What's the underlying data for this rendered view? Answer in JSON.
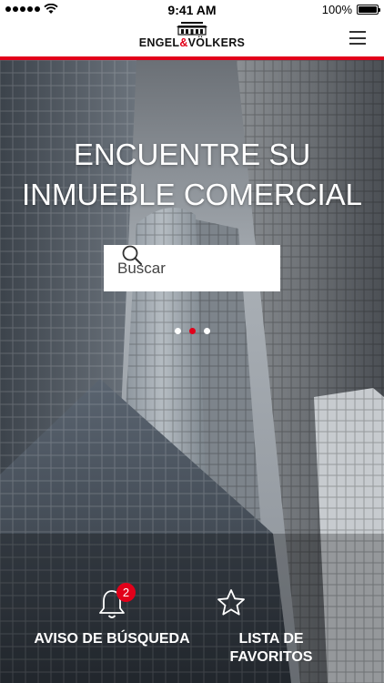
{
  "status_bar": {
    "time": "9:41 AM",
    "battery": "100%"
  },
  "header": {
    "logo_left": "ENGEL",
    "logo_amp": "&",
    "logo_right": "VÖLKERS",
    "menu_icon": "hamburger-menu-icon"
  },
  "hero": {
    "title_line1": "ENCUENTRE SU",
    "title_line2": "INMUEBLE COMERCIAL",
    "search_placeholder": "Buscar",
    "carousel": {
      "count": 3,
      "active_index": 1
    }
  },
  "actions": {
    "search_alert_label": "AVISO DE BÚSQUEDA",
    "search_alert_badge": "2",
    "favorites_line1": "LISTA DE",
    "favorites_line2": "FAVORITOS"
  },
  "colors": {
    "brand_red": "#e2001a"
  }
}
